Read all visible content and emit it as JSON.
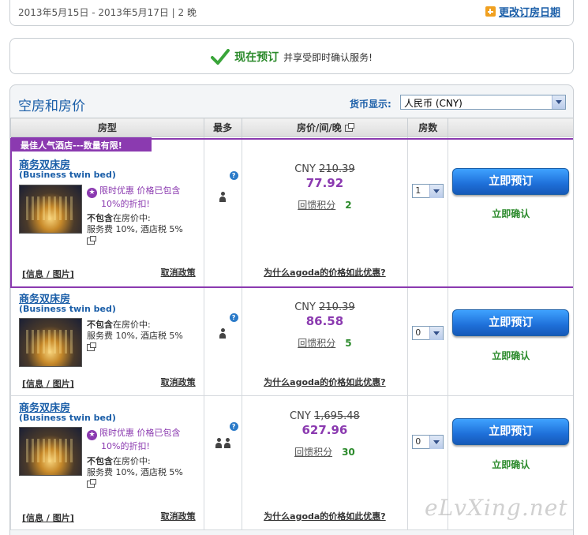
{
  "datebar": {
    "dates": "2013年5月15日 - 2013年5月17日 | 2 晚",
    "change_label": "更改订房日期"
  },
  "bookbar": {
    "now": "现在预订",
    "rest": "并享受即时确认服务!"
  },
  "rooms": {
    "title": "空房和房价",
    "currency_label": "货币显示:",
    "currency_value": "人民币 (CNY)",
    "headers": {
      "type": "房型",
      "max": "最多",
      "price": "房价/间/晚",
      "count": "房数"
    },
    "list": [
      {
        "banner": "最佳人气酒店---数量有限!",
        "name": "商务双床房",
        "sub": "(Business twin bed)",
        "promo_line1": "限时优惠 价格已包含",
        "promo_line2": "10%的折扣!",
        "notincl_line1_bold": "不包含",
        "notincl_line1_rest": "在房价中:",
        "notincl_line2": "服务费 10%, 酒店税 5%",
        "info_link": "[信息 / 图片]",
        "cancel_link": "取消政策",
        "currency": "CNY",
        "old_price": "210.39",
        "new_price": "77.92",
        "points_label": "回馈积分",
        "points_value": "2",
        "why_link": "为什么agoda的价格如此优惠?",
        "qty": "1",
        "book_label": "立即预订",
        "instant_label": "立即确认",
        "guests": 1
      },
      {
        "name": "商务双床房",
        "sub": "(Business twin bed)",
        "notincl_line1_bold": "不包含",
        "notincl_line1_rest": "在房价中:",
        "notincl_line2": "服务费 10%, 酒店税 5%",
        "info_link": "[信息 / 图片]",
        "cancel_link": "取消政策",
        "currency": "CNY",
        "old_price": "210.39",
        "new_price": "86.58",
        "points_label": "回馈积分",
        "points_value": "5",
        "why_link": "为什么agoda的价格如此优惠?",
        "qty": "0",
        "book_label": "立即预订",
        "instant_label": "立即确认",
        "guests": 1
      },
      {
        "name": "商务双床房",
        "sub": "(Business twin bed)",
        "promo_line1": "限时优惠 价格已包含",
        "promo_line2": "10%的折扣!",
        "notincl_line1_bold": "不包含",
        "notincl_line1_rest": "在房价中:",
        "notincl_line2": "服务费 10%, 酒店税 5%",
        "info_link": "[信息 / 图片]",
        "cancel_link": "取消政策",
        "currency": "CNY",
        "old_price": "1,695.48",
        "new_price": "627.96",
        "points_label": "回馈积分",
        "points_value": "30",
        "why_link": "为什么agoda的价格如此优惠?",
        "qty": "0",
        "book_label": "立即预订",
        "instant_label": "立即确认",
        "guests": 2
      }
    ]
  },
  "watermark": "eLvXing.net",
  "colors": {
    "brand_blue": "#1a5ea8",
    "promo_purple": "#8b3ab0",
    "confirm_green": "#2b8a2b",
    "button_blue": "#1e6fd8"
  }
}
